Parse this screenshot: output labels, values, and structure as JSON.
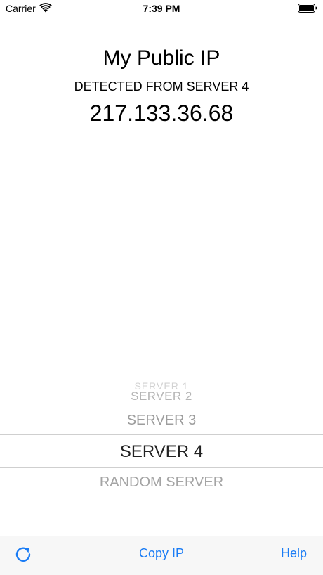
{
  "status_bar": {
    "carrier": "Carrier",
    "time": "7:39 PM"
  },
  "main": {
    "title": "My Public IP",
    "detected_label": "DETECTED FROM SERVER 4",
    "ip_address": "217.133.36.68"
  },
  "picker": {
    "items": [
      "SERVER 1",
      "SERVER 2",
      "SERVER 3",
      "SERVER 4",
      "RANDOM SERVER"
    ],
    "selected": "SERVER 4"
  },
  "toolbar": {
    "refresh_icon": "refresh-icon",
    "copy_label": "Copy IP",
    "help_label": "Help"
  },
  "colors": {
    "accent": "#1a7cf5",
    "text": "#000000",
    "picker_selected": "#222222",
    "picker_dim": "#a4a4a4"
  }
}
